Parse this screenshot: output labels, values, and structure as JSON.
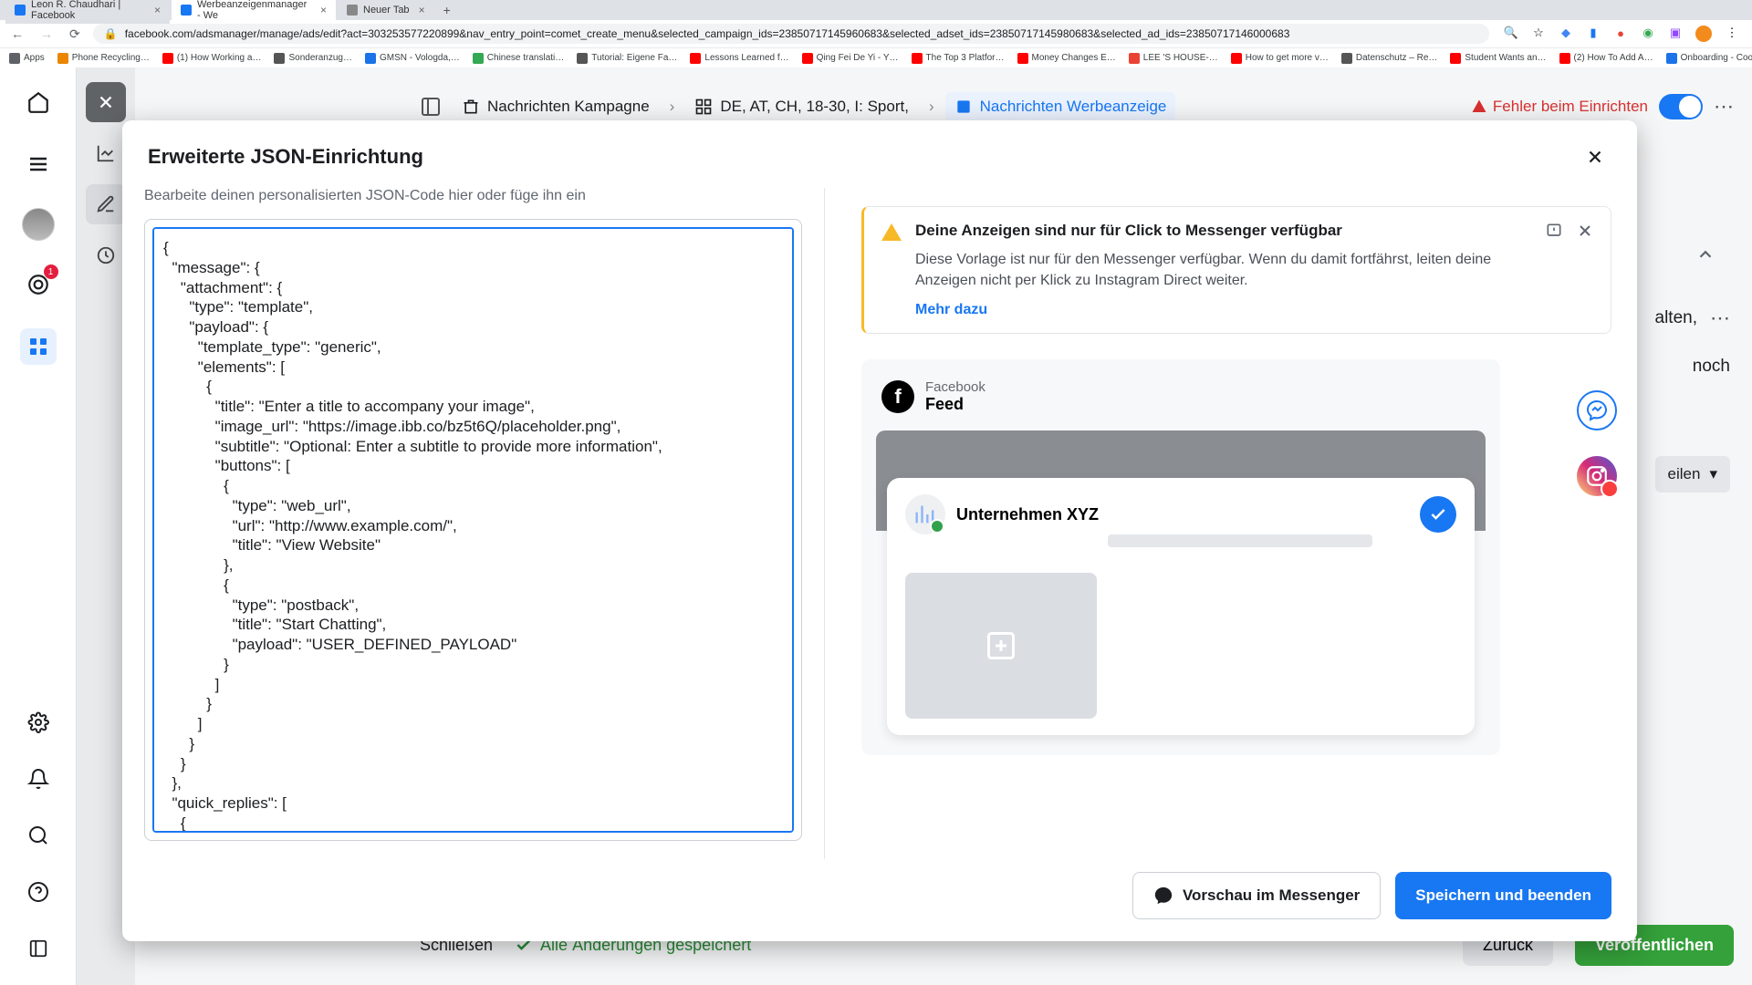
{
  "browser": {
    "tabs": [
      {
        "title": "Leon R. Chaudhari | Facebook",
        "icon_color": "#1877f2"
      },
      {
        "title": "Werbeanzeigenmanager - We",
        "icon_color": "#1877f2"
      },
      {
        "title": "Neuer Tab",
        "icon_color": "#888"
      }
    ],
    "url": "facebook.com/adsmanager/manage/ads/edit?act=303253577220899&nav_entry_point=comet_create_menu&selected_campaign_ids=23850717145960683&selected_adset_ids=23850717145980683&selected_ad_ids=23850717146000683",
    "bookmarks": [
      "Apps",
      "Phone Recycling…",
      "(1) How Working a…",
      "Sonderanzug…",
      "GMSN - Vologda,…",
      "Chinese translati…",
      "Tutorial: Eigene Fa…",
      "Lessons Learned f…",
      "Qing Fei De Yi - Y…",
      "The Top 3 Platfor…",
      "Money Changes E…",
      "LEE 'S HOUSE-…",
      "How to get more v…",
      "Datenschutz – Re…",
      "Student Wants an…",
      "(2) How To Add A…",
      "Onboarding - Cooki…"
    ]
  },
  "global_nav": {
    "badge_count": "1"
  },
  "breadcrumb": {
    "campaign": "Nachrichten Kampagne",
    "adset": "DE, AT, CH, 18-30, I: Sport,",
    "ad": "Nachrichten Werbeanzeige",
    "error": "Fehler beim Einrichten"
  },
  "peek": {
    "line1": "alten,",
    "line2": "noch",
    "split_label": "eilen"
  },
  "footer": {
    "close": "Schließen",
    "saved": "Alle Änderungen gespeichert",
    "back": "Zurück",
    "publish": "Veröffentlichen"
  },
  "modal": {
    "title": "Erweiterte JSON-Einrichtung",
    "editor_label": "Bearbeite deinen personalisierten JSON-Code hier oder füge ihn ein",
    "code": "{\n  \"message\": {\n    \"attachment\": {\n      \"type\": \"template\",\n      \"payload\": {\n        \"template_type\": \"generic\",\n        \"elements\": [\n          {\n            \"title\": \"Enter a title to accompany your image\",\n            \"image_url\": \"https://image.ibb.co/bz5t6Q/placeholder.png\",\n            \"subtitle\": \"Optional: Enter a subtitle to provide more information\",\n            \"buttons\": [\n              {\n                \"type\": \"web_url\",\n                \"url\": \"http://www.example.com/\",\n                \"title\": \"View Website\"\n              },\n              {\n                \"type\": \"postback\",\n                \"title\": \"Start Chatting\",\n                \"payload\": \"USER_DEFINED_PAYLOAD\"\n              }\n            ]\n          }\n        ]\n      }\n    }\n  },\n  \"quick_replies\": [\n    {\n      \"content_type\": \"text\",",
    "alert": {
      "title": "Deine Anzeigen sind nur für Click to Messenger verfügbar",
      "text": "Diese Vorlage ist nur für den Messenger verfügbar. Wenn du damit fortfährst, leiten deine Anzeigen nicht per Klick zu Instagram Direct weiter.",
      "link": "Mehr dazu"
    },
    "preview": {
      "platform": "Facebook",
      "placement": "Feed",
      "company": "Unternehmen XYZ"
    },
    "footer": {
      "preview_btn": "Vorschau im Messenger",
      "save_btn": "Speichern und beenden"
    }
  }
}
